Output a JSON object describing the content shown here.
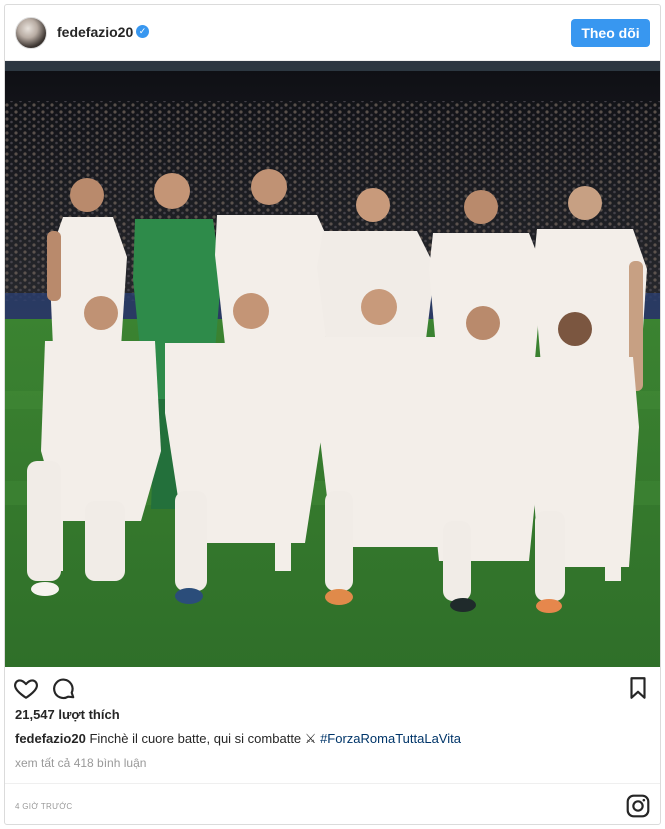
{
  "header": {
    "username": "fedefazio20",
    "follow_label": "Theo dõi"
  },
  "actions": {
    "like_icon": "heart-icon",
    "comment_icon": "comment-icon",
    "save_icon": "bookmark-icon"
  },
  "likes": {
    "count": "21,547",
    "label": "lượt thích"
  },
  "caption": {
    "username": "fedefazio20",
    "text": "Finchè il cuore batte, qui si combatte ⚔",
    "hashtag": "#ForzaRomaTuttaLaVita"
  },
  "comments": {
    "view_all": "xem tất cả 418 bình luận"
  },
  "footer": {
    "time_ago": "4 GIỜ TRƯỚC",
    "logo": "instagram-icon"
  },
  "colors": {
    "accent": "#3897f0",
    "hashtag": "#003569",
    "muted": "#999999",
    "kit_white": "#f3eee9",
    "keeper_green": "#2e8b4a",
    "pitch_green": "#3f8a34"
  }
}
